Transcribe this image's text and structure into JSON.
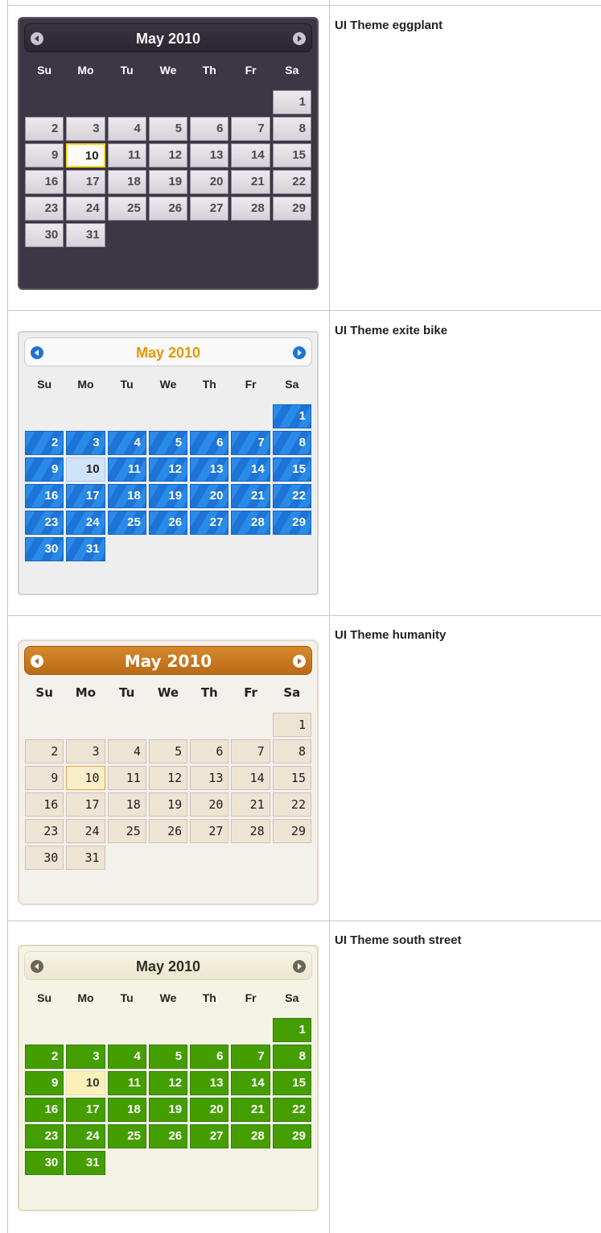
{
  "dow": [
    "Su",
    "Mo",
    "Tu",
    "We",
    "Th",
    "Fr",
    "Sa"
  ],
  "calendars": [
    {
      "theme_name": "UI Theme eggplant",
      "title": "May 2010",
      "days": [
        "1",
        "2",
        "3",
        "4",
        "5",
        "6",
        "7",
        "8",
        "9",
        "10",
        "11",
        "12",
        "13",
        "14",
        "15",
        "16",
        "17",
        "18",
        "19",
        "20",
        "21",
        "22",
        "23",
        "24",
        "25",
        "26",
        "27",
        "28",
        "29",
        "30",
        "31"
      ],
      "today": "10"
    },
    {
      "theme_name": "UI Theme exite bike",
      "title": "May 2010",
      "days": [
        "1",
        "2",
        "3",
        "4",
        "5",
        "6",
        "7",
        "8",
        "9",
        "10",
        "11",
        "12",
        "13",
        "14",
        "15",
        "16",
        "17",
        "18",
        "19",
        "20",
        "21",
        "22",
        "23",
        "24",
        "25",
        "26",
        "27",
        "28",
        "29",
        "30",
        "31"
      ],
      "today": "10"
    },
    {
      "theme_name": "UI Theme humanity",
      "title": "May 2010",
      "days": [
        "1",
        "2",
        "3",
        "4",
        "5",
        "6",
        "7",
        "8",
        "9",
        "10",
        "11",
        "12",
        "13",
        "14",
        "15",
        "16",
        "17",
        "18",
        "19",
        "20",
        "21",
        "22",
        "23",
        "24",
        "25",
        "26",
        "27",
        "28",
        "29",
        "30",
        "31"
      ],
      "today": "10"
    },
    {
      "theme_name": "UI Theme south street",
      "title": "May 2010",
      "days": [
        "1",
        "2",
        "3",
        "4",
        "5",
        "6",
        "7",
        "8",
        "9",
        "10",
        "11",
        "12",
        "13",
        "14",
        "15",
        "16",
        "17",
        "18",
        "19",
        "20",
        "21",
        "22",
        "23",
        "24",
        "25",
        "26",
        "27",
        "28",
        "29",
        "30",
        "31"
      ],
      "today": "10"
    }
  ],
  "icons": {
    "prev": "prev-arrow-icon",
    "next": "next-arrow-icon"
  }
}
